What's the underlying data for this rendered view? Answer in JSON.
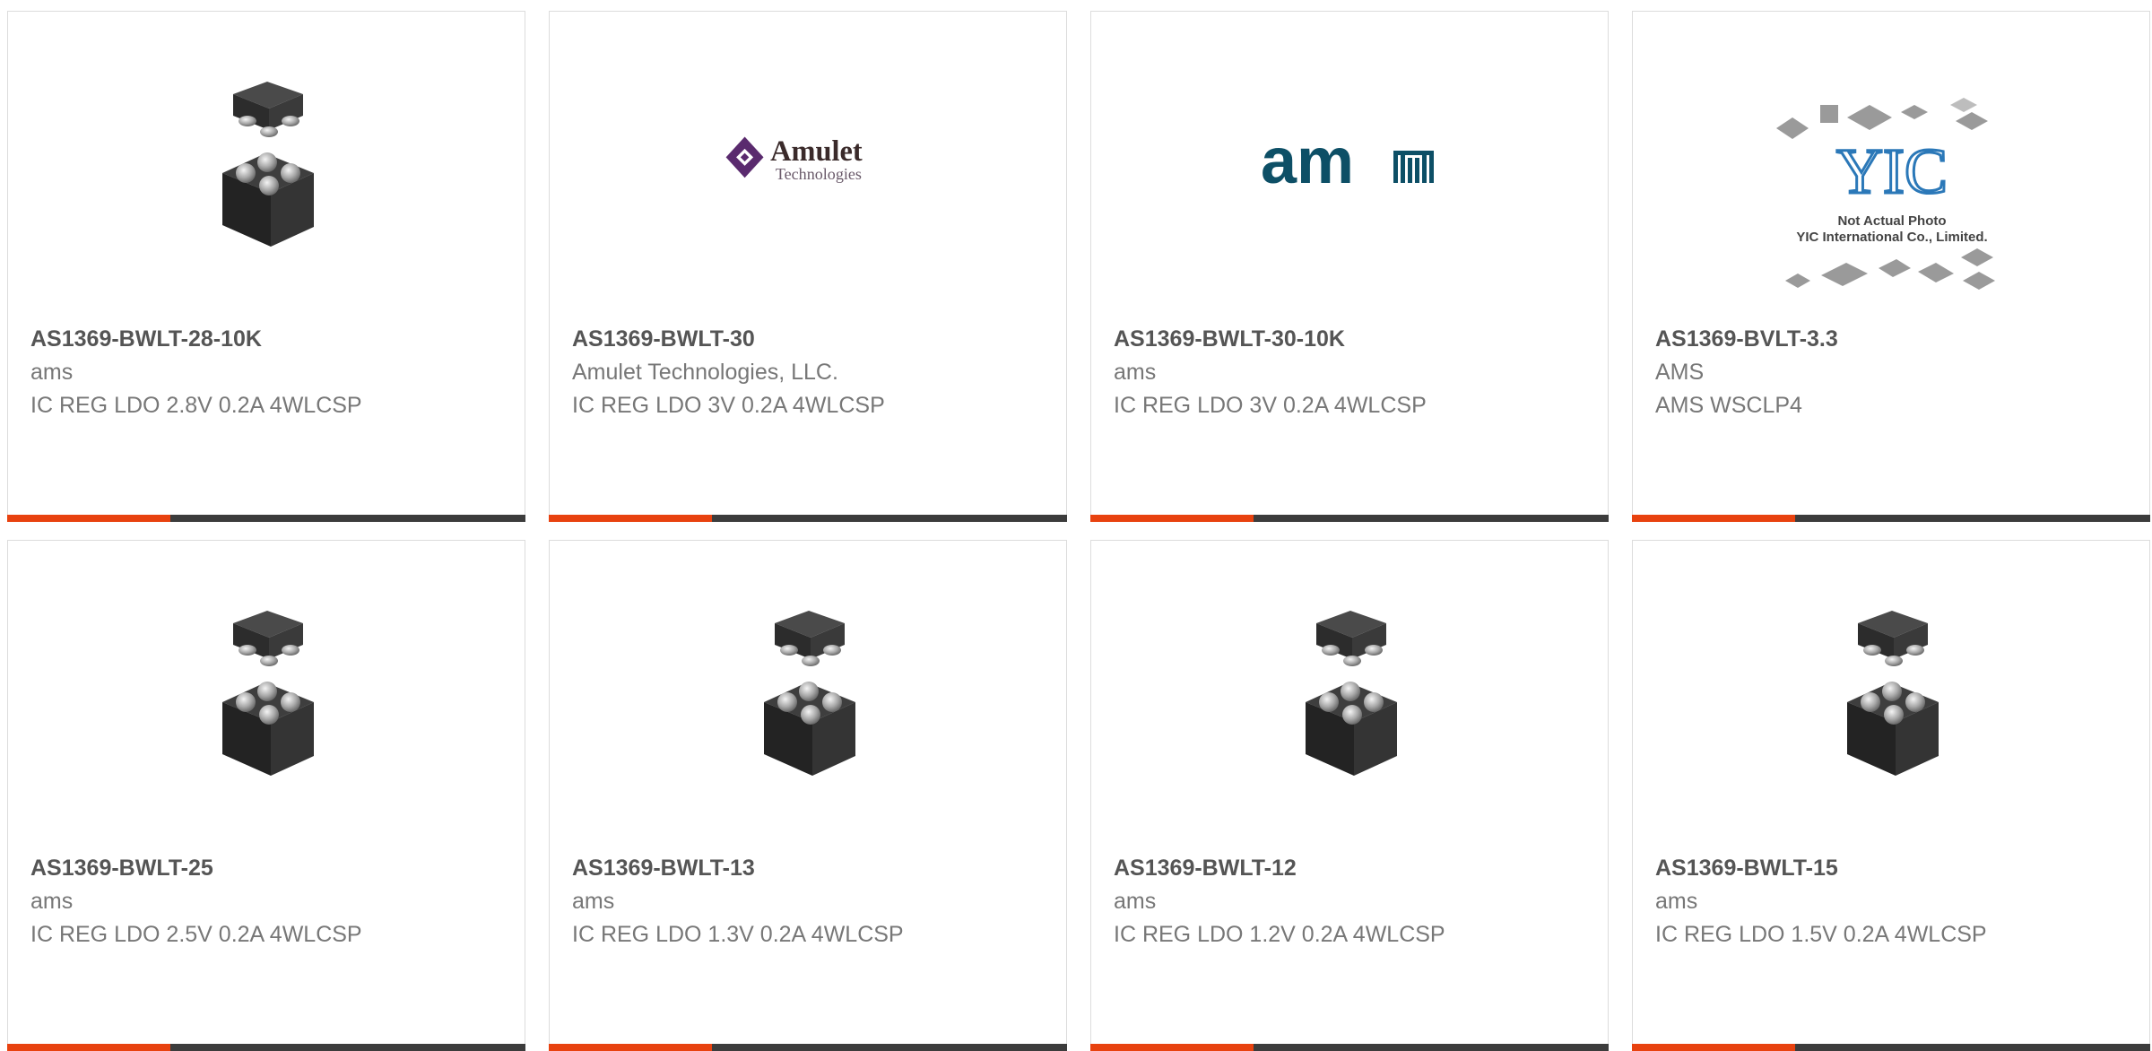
{
  "products": [
    {
      "part_number": "AS1369-BWLT-28-10K",
      "manufacturer": "ams",
      "description": "IC REG LDO 2.8V 0.2A 4WLCSP",
      "image": "wlcsp-chip-image"
    },
    {
      "part_number": "AS1369-BWLT-30",
      "manufacturer": "Amulet Technologies, LLC.",
      "description": "IC REG LDO 3V 0.2A 4WLCSP",
      "image": "amulet-logo",
      "logo_text": {
        "title": "Amulet",
        "subtitle": "Technologies"
      }
    },
    {
      "part_number": "AS1369-BWLT-30-10K",
      "manufacturer": "ams",
      "description": "IC REG LDO 3V 0.2A 4WLCSP",
      "image": "ams-logo",
      "logo_text": {
        "title": "am"
      }
    },
    {
      "part_number": "AS1369-BVLT-3.3",
      "manufacturer": "AMS",
      "description": "AMS WSCLP4",
      "image": "yic-placeholder-image",
      "logo_text": {
        "title": "YIC",
        "line1": "Not Actual Photo",
        "line2": "YIC International Co., Limited."
      }
    },
    {
      "part_number": "AS1369-BWLT-25",
      "manufacturer": "ams",
      "description": "IC REG LDO 2.5V 0.2A 4WLCSP",
      "image": "wlcsp-chip-image"
    },
    {
      "part_number": "AS1369-BWLT-13",
      "manufacturer": "ams",
      "description": "IC REG LDO 1.3V 0.2A 4WLCSP",
      "image": "wlcsp-chip-image"
    },
    {
      "part_number": "AS1369-BWLT-12",
      "manufacturer": "ams",
      "description": "IC REG LDO 1.2V 0.2A 4WLCSP",
      "image": "wlcsp-chip-image"
    },
    {
      "part_number": "AS1369-BWLT-15",
      "manufacturer": "ams",
      "description": "IC REG LDO 1.5V 0.2A 4WLCSP",
      "image": "wlcsp-chip-image"
    }
  ],
  "colors": {
    "accent": "#e8420f",
    "bar": "#3c3c3c",
    "part_number_text": "#555555",
    "body_text": "#777777",
    "amulet_purple": "#5a2a6e",
    "ams_teal": "#0d4f66",
    "yic_blue": "#2b78b8"
  }
}
